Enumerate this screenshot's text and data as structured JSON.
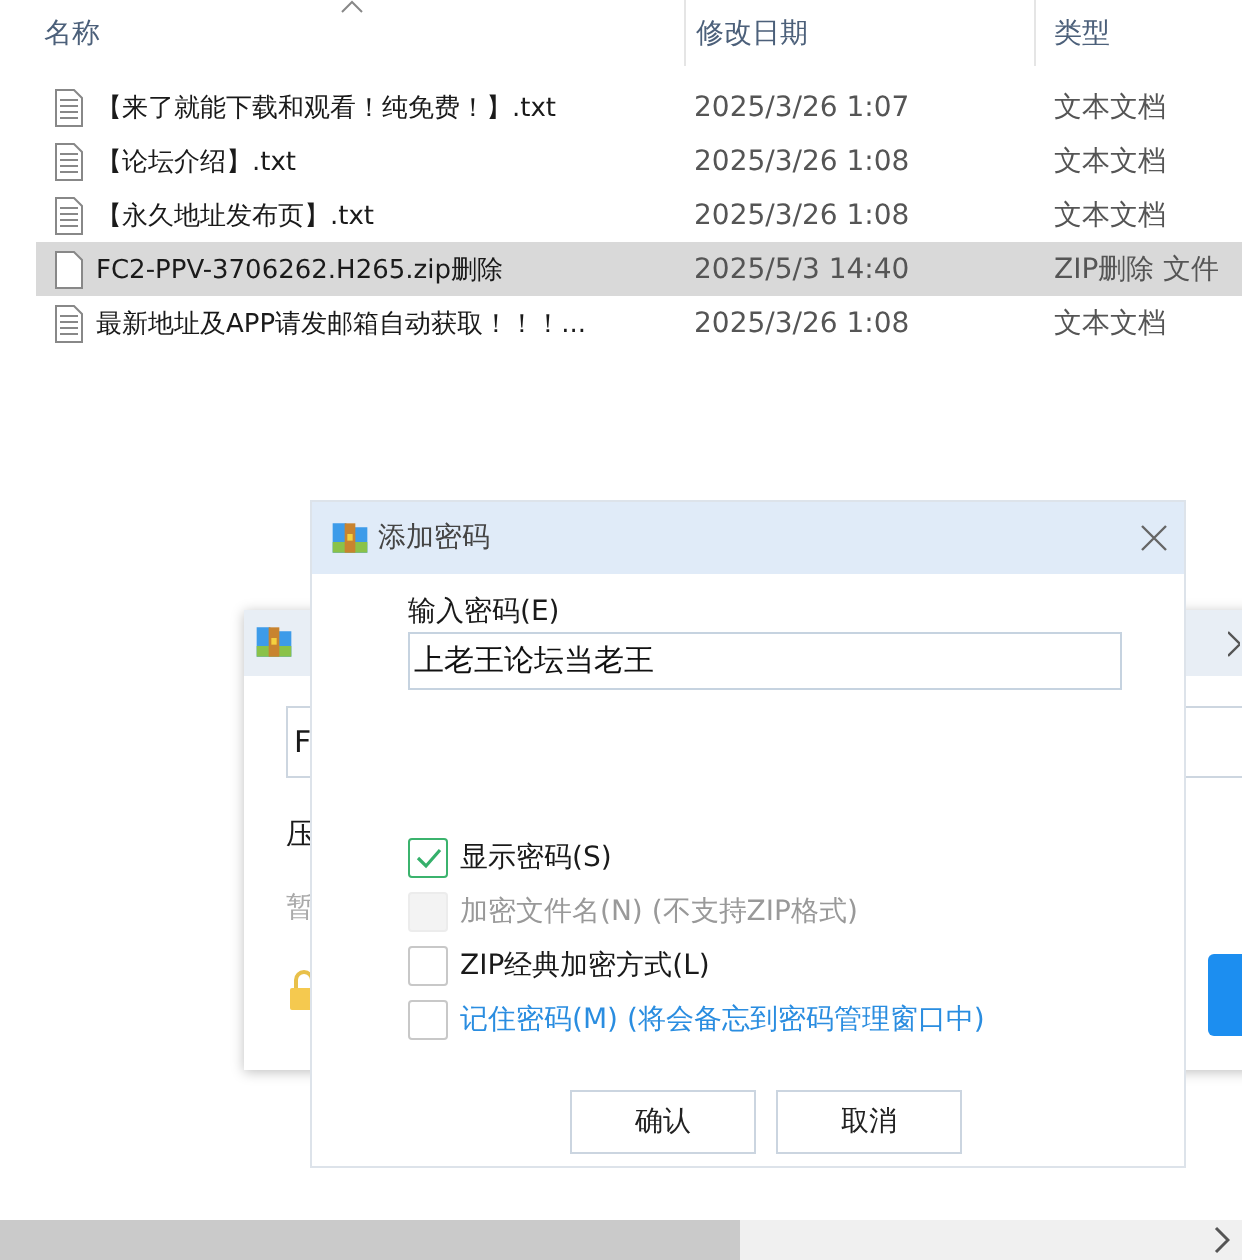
{
  "explorer": {
    "columns": [
      {
        "label": "名称",
        "sorted": true
      },
      {
        "label": "修改日期",
        "sorted": false
      },
      {
        "label": "类型",
        "sorted": false
      }
    ],
    "rows": [
      {
        "kind": "text",
        "name": "【来了就能下载和观看！纯免费！】.txt",
        "date": "2025/3/26 1:07",
        "type": "文本文档",
        "selected": false
      },
      {
        "kind": "text",
        "name": "【论坛介绍】.txt",
        "date": "2025/3/26 1:08",
        "type": "文本文档",
        "selected": false
      },
      {
        "kind": "text",
        "name": "【永久地址发布页】.txt",
        "date": "2025/3/26 1:08",
        "type": "文本文档",
        "selected": false
      },
      {
        "kind": "blank",
        "name": "FC2-PPV-3706262.H265.zip删除",
        "date": "2025/5/3 14:40",
        "type": "ZIP删除 文件",
        "selected": true
      },
      {
        "kind": "text",
        "name": "最新地址及APP请发邮箱自动获取！！！...",
        "date": "2025/3/26 1:08",
        "type": "文本文档",
        "selected": false
      }
    ]
  },
  "back_dialog": {
    "field_value": "F",
    "label": "压",
    "hint": "暂"
  },
  "dialog": {
    "title": "添加密码",
    "password_label": "输入密码(E)",
    "password_value": "上老王论坛当老王",
    "options": [
      {
        "kind": "plain",
        "label": "显示密码(S)",
        "checked": true,
        "disabled": false
      },
      {
        "kind": "plain",
        "label": "加密文件名(N) (不支持ZIP格式)",
        "checked": false,
        "disabled": true
      },
      {
        "kind": "plain",
        "label": "ZIP经典加密方式(L)",
        "checked": false,
        "disabled": false
      },
      {
        "kind": "accent",
        "label": "记住密码(M) (将会备忘到密码管理窗口中)",
        "checked": false,
        "disabled": false
      }
    ],
    "buttons": [
      "确认",
      "取消"
    ]
  }
}
